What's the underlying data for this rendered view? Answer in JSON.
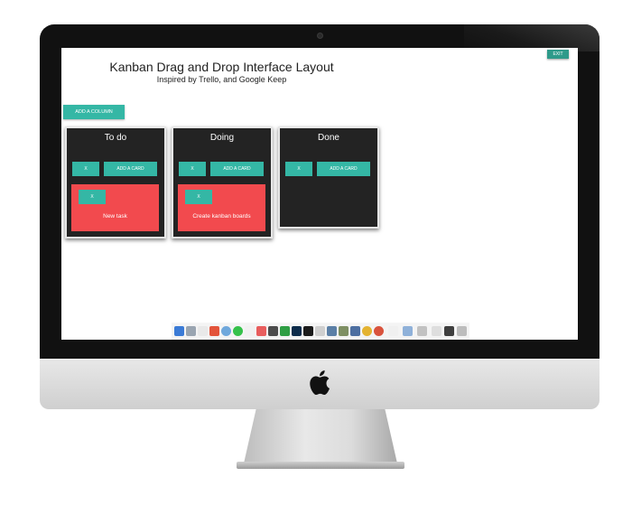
{
  "app": {
    "title": "Kanban Drag and Drop Interface Layout",
    "subtitle": "Inspired by Trello, and Google Keep",
    "exit_label": "EXIT",
    "add_column_label": "ADD A COLUMN"
  },
  "columns": [
    {
      "title": "To do",
      "remove_label": "X",
      "add_card_label": "ADD A CARD",
      "cards": [
        {
          "remove_label": "X",
          "text": "New task"
        }
      ]
    },
    {
      "title": "Doing",
      "remove_label": "X",
      "add_card_label": "ADD A CARD",
      "cards": [
        {
          "remove_label": "X",
          "text": "Create kanban boards"
        }
      ]
    },
    {
      "title": "Done",
      "remove_label": "X",
      "add_card_label": "ADD A CARD",
      "cards": []
    }
  ],
  "colors": {
    "accent": "#34b7a5",
    "card": "#f24a4e",
    "column_bg": "#232323",
    "exit": "#2e9a8a"
  },
  "dock": {
    "icons": [
      "finder-icon",
      "launchpad-icon",
      "calendar-icon",
      "safari-icon",
      "chrome-icon",
      "whatsapp-icon",
      "itunes-icon",
      "notes-icon",
      "app-icon",
      "photoshop-icon",
      "terminal-icon",
      "app-icon-2",
      "preview-icon",
      "photos-icon",
      "chrome-icon-2",
      "chrome-icon-3",
      "app-icon-3",
      "app-icon-4",
      "app-icon-5",
      "app-icon-6",
      "trash-icon"
    ]
  }
}
